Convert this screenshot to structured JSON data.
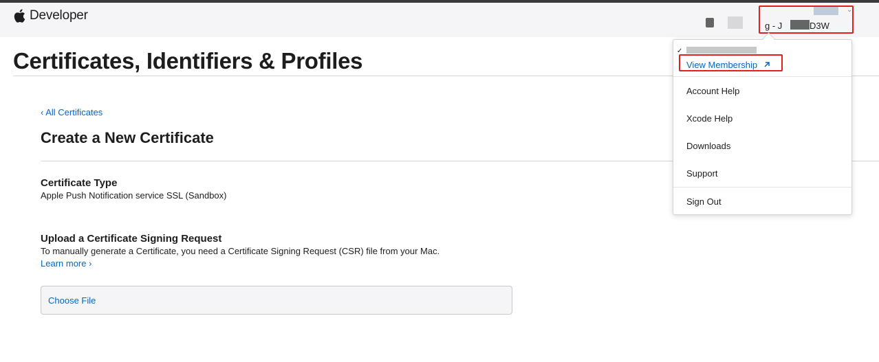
{
  "header": {
    "brand": "Developer",
    "team_text": "g - J           D3W",
    "chevron": "⌄"
  },
  "page": {
    "title": "Certificates, Identifiers & Profiles"
  },
  "main": {
    "back_link": "‹ All Certificates",
    "heading": "Create a New Certificate",
    "certificate_type_label": "Certificate Type",
    "certificate_type_value": "Apple Push Notification service SSL (Sandbox)",
    "csr_label": "Upload a Certificate Signing Request",
    "csr_description": "To manually generate a Certificate, you need a Certificate Signing Request (CSR) file from your Mac.",
    "learn_more": "Learn more ›",
    "choose_file": "Choose File"
  },
  "dropdown": {
    "check": "✓",
    "view_membership": "View Membership",
    "items": [
      "Account Help",
      "Xcode Help",
      "Downloads",
      "Support"
    ],
    "sign_out": "Sign Out"
  },
  "colors": {
    "link": "#0066cc",
    "highlight": "#e02020",
    "header_bg": "#f5f5f7"
  }
}
